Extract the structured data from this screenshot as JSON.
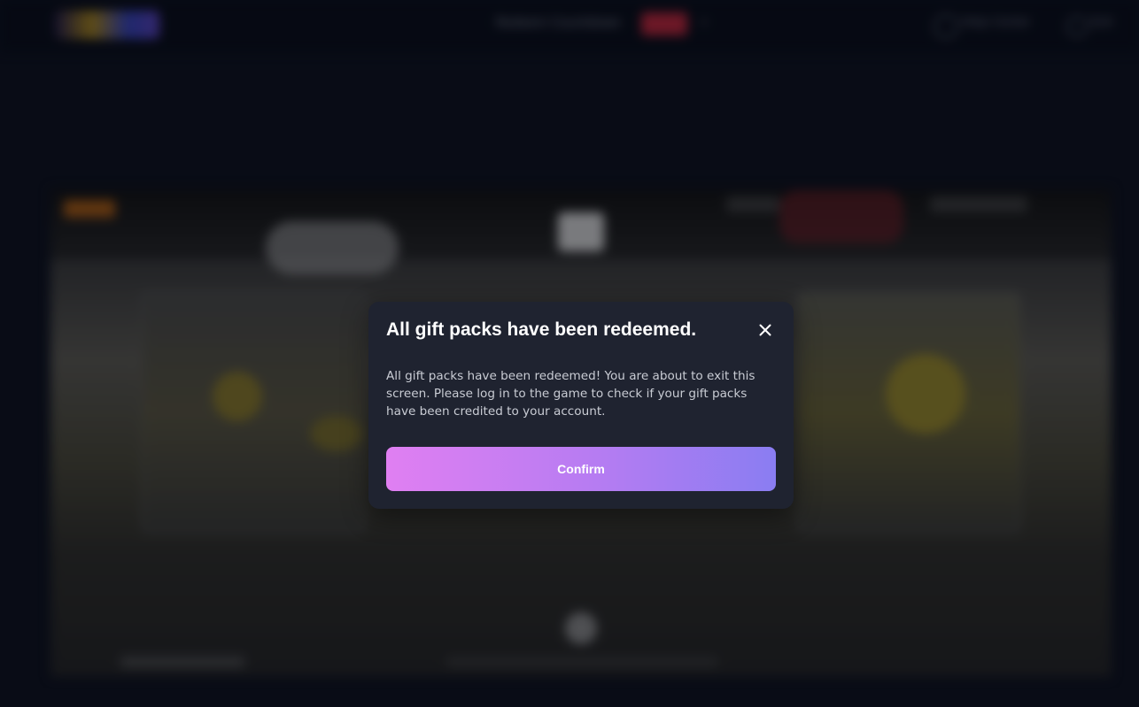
{
  "background": {
    "nav_text": "Redeem Countdown",
    "help_label": "Help Center",
    "exit_label": "Exit"
  },
  "modal": {
    "title": "All gift packs have been redeemed.",
    "message": "All gift packs have been redeemed! You are about to exit this screen. Please log in to the game to check if your gift packs have been credited to your account.",
    "confirm_label": "Confirm",
    "close_icon": "close-icon"
  },
  "colors": {
    "modal_bg": "#1f2330",
    "button_gradient_start": "#e07ff2",
    "button_gradient_end": "#8a7df2",
    "page_bg": "#0b0f1c"
  }
}
